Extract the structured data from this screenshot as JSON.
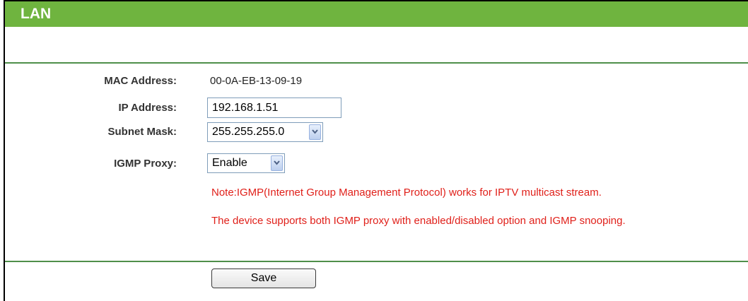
{
  "header": {
    "title": "LAN"
  },
  "form": {
    "mac": {
      "label": "MAC Address:",
      "value": "00-0A-EB-13-09-19"
    },
    "ip": {
      "label": "IP Address:",
      "value": "192.168.1.51"
    },
    "subnet": {
      "label": "Subnet Mask:",
      "selected": "255.255.255.0"
    },
    "igmp": {
      "label": "IGMP Proxy:",
      "selected": "Enable"
    }
  },
  "notes": {
    "line1": "Note:IGMP(Internet Group Management Protocol) works for IPTV multicast stream.",
    "line2": "The device supports both IGMP proxy with enabled/disabled option and IGMP snooping."
  },
  "actions": {
    "save_label": "Save"
  },
  "colors": {
    "header_bg": "#6fb43f",
    "divider": "#4f8f4a",
    "note_text": "#e0201a"
  }
}
